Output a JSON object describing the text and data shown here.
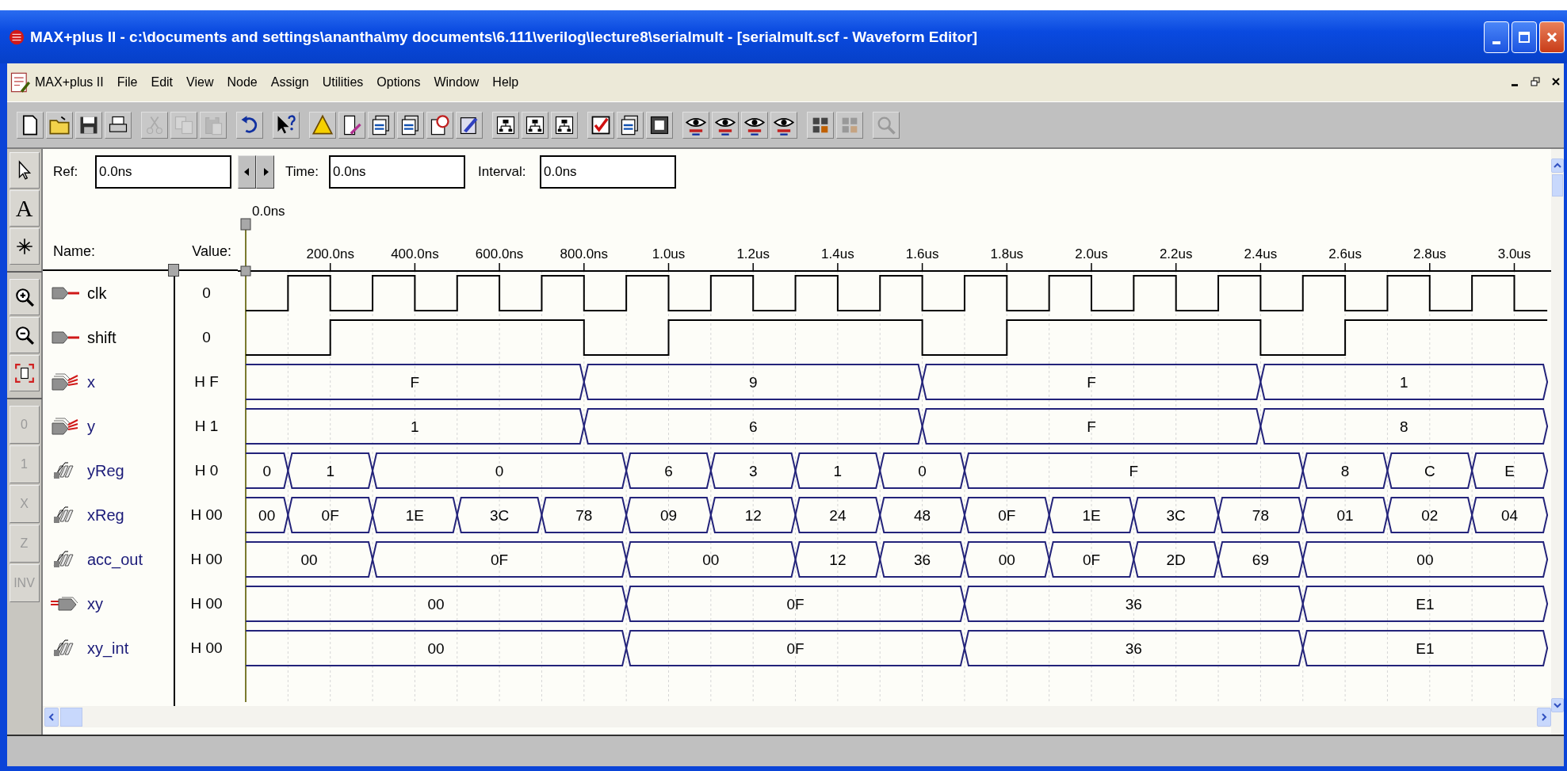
{
  "window": {
    "title": "MAX+plus II - c:\\documents and settings\\anantha\\my documents\\6.111\\verilog\\lecture8\\serialmult - [serialmult.scf - Waveform Editor]"
  },
  "menu": [
    "MAX+plus II",
    "File",
    "Edit",
    "View",
    "Node",
    "Assign",
    "Utilities",
    "Options",
    "Window",
    "Help"
  ],
  "toolbar": [
    [
      {
        "kind": "new",
        "disabled": false
      },
      {
        "kind": "open",
        "disabled": false
      },
      {
        "kind": "save",
        "disabled": false
      },
      {
        "kind": "print",
        "disabled": false
      }
    ],
    [
      {
        "kind": "cut",
        "disabled": true
      },
      {
        "kind": "copy",
        "disabled": true
      },
      {
        "kind": "paste",
        "disabled": true
      }
    ],
    [
      {
        "kind": "undo",
        "disabled": false
      }
    ],
    [
      {
        "kind": "help",
        "disabled": false
      }
    ],
    [
      {
        "kind": "triangle",
        "disabled": false
      },
      {
        "kind": "docpen",
        "disabled": false
      },
      {
        "kind": "stack",
        "disabled": false
      },
      {
        "kind": "stack",
        "disabled": false
      },
      {
        "kind": "clock",
        "disabled": false
      },
      {
        "kind": "chart",
        "disabled": false
      }
    ],
    [
      {
        "kind": "tree",
        "disabled": false
      },
      {
        "kind": "tree",
        "disabled": false
      },
      {
        "kind": "tree",
        "disabled": false
      }
    ],
    [
      {
        "kind": "check",
        "disabled": false
      },
      {
        "kind": "stack",
        "disabled": false
      },
      {
        "kind": "chip",
        "disabled": false
      }
    ],
    [
      {
        "kind": "eye",
        "disabled": false
      },
      {
        "kind": "eye",
        "disabled": false
      },
      {
        "kind": "eye",
        "disabled": false
      },
      {
        "kind": "eye",
        "disabled": false
      }
    ],
    [
      {
        "kind": "grid",
        "disabled": false
      },
      {
        "kind": "grid",
        "disabled": true
      }
    ],
    [
      {
        "kind": "magnifier",
        "disabled": true
      }
    ]
  ],
  "palette": [
    {
      "kind": "pointer",
      "disabled": false
    },
    {
      "kind": "glyph",
      "glyph": "A",
      "disabled": false
    },
    {
      "kind": "snap",
      "disabled": false
    },
    {
      "kind": "separator"
    },
    {
      "kind": "zoom_in",
      "disabled": false
    },
    {
      "kind": "zoom_out",
      "disabled": false
    },
    {
      "kind": "fit",
      "disabled": false
    },
    {
      "kind": "separator"
    },
    {
      "kind": "level",
      "glyph": "0",
      "disabled": true
    },
    {
      "kind": "level",
      "glyph": "1",
      "disabled": true
    },
    {
      "kind": "level",
      "glyph": "X",
      "disabled": true
    },
    {
      "kind": "level",
      "glyph": "Z",
      "disabled": true
    },
    {
      "kind": "level",
      "glyph": "INV",
      "disabled": true
    }
  ],
  "ref": {
    "label": "Ref:",
    "value": "0.0ns"
  },
  "time": {
    "label": "Time:",
    "value": "0.0ns"
  },
  "interval": {
    "label": "Interval:",
    "value": "0.0ns"
  },
  "cursor_label": "0.0ns",
  "columns": {
    "name": "Name:",
    "value": "Value:"
  },
  "time_ticks": [
    "200.0ns",
    "400.0ns",
    "600.0ns",
    "800.0ns",
    "1.0us",
    "1.2us",
    "1.4us",
    "1.6us",
    "1.8us",
    "2.0us",
    "2.2us",
    "2.4us",
    "2.6us",
    "2.8us",
    "3.0us"
  ],
  "signals": [
    {
      "name": "clk",
      "value": "0",
      "kind": "input"
    },
    {
      "name": "shift",
      "value": "0",
      "kind": "input"
    },
    {
      "name": "x",
      "value": "H F",
      "kind": "input_group",
      "values": [
        "F",
        "9",
        "F",
        "1"
      ]
    },
    {
      "name": "y",
      "value": "H 1",
      "kind": "input_group",
      "values": [
        "1",
        "6",
        "F",
        "8"
      ]
    },
    {
      "name": "yReg",
      "value": "H 0",
      "kind": "buried_group",
      "values": [
        "0",
        "1",
        "0",
        "6",
        "3",
        "1",
        "0",
        "F",
        "8",
        "C",
        "E"
      ]
    },
    {
      "name": "xReg",
      "value": "H 00",
      "kind": "buried_group",
      "values": [
        "00",
        "0F",
        "1E",
        "3C",
        "78",
        "09",
        "12",
        "24",
        "48",
        "0F",
        "1E",
        "3C",
        "78",
        "01",
        "02",
        "04"
      ]
    },
    {
      "name": "acc_out",
      "value": "H 00",
      "kind": "buried_group",
      "values": [
        "00",
        "0F",
        "00",
        "12",
        "36",
        "00",
        "0F",
        "2D",
        "69",
        "00"
      ]
    },
    {
      "name": "xy",
      "value": "H 00",
      "kind": "output_group",
      "values": [
        "00",
        "0F",
        "36",
        "E1"
      ]
    },
    {
      "name": "xy_int",
      "value": "H 00",
      "kind": "buried_group",
      "values": [
        "00",
        "0F",
        "36",
        "E1"
      ]
    }
  ]
}
